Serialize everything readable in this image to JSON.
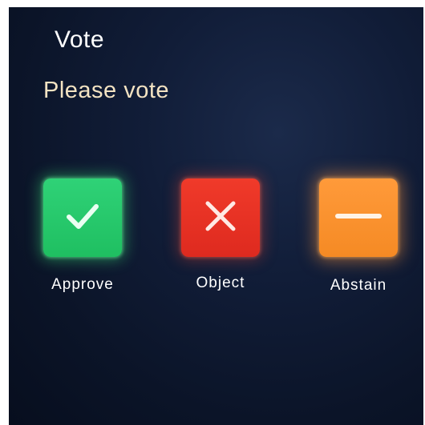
{
  "header": {
    "title": "Vote",
    "subtitle": "Please vote"
  },
  "options": [
    {
      "label": "Approve",
      "icon": "check-icon",
      "color": "#22c766"
    },
    {
      "label": "Object",
      "icon": "close-icon",
      "color": "#e8301f"
    },
    {
      "label": "Abstain",
      "icon": "minus-icon",
      "color": "#f8912c"
    }
  ],
  "colors": {
    "background": "#0e1830",
    "title": "#ffffff",
    "subtitle": "#f3e3c2"
  }
}
